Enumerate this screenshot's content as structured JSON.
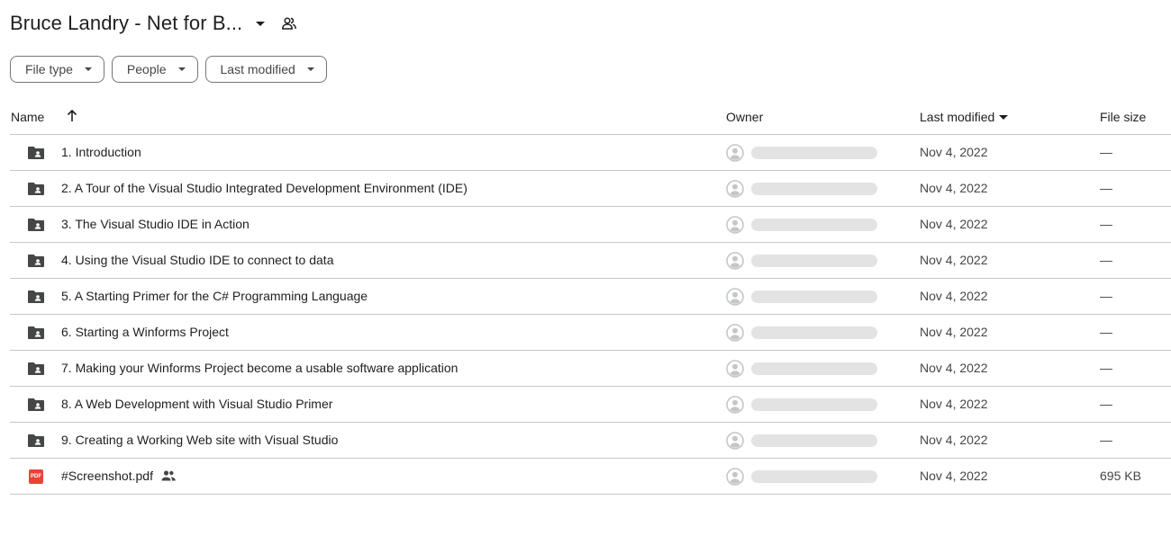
{
  "header": {
    "folder_title": "Bruce Landry - Net for B...",
    "caret_icon": "arrow-drop-down-icon",
    "shared_icon": "people-outline-icon"
  },
  "filters": [
    {
      "label": "File type"
    },
    {
      "label": "People"
    },
    {
      "label": "Last modified"
    }
  ],
  "table": {
    "columns": {
      "name": "Name",
      "owner": "Owner",
      "last_modified": "Last modified",
      "file_size": "File size"
    },
    "sort": {
      "name_arrow": "arrow-upward-icon",
      "modified_caret": "arrow-drop-down-icon"
    },
    "rows": [
      {
        "icon": "shared-folder-icon",
        "name": "1. Introduction",
        "modified": "Nov 4, 2022",
        "size": "—",
        "shared": false
      },
      {
        "icon": "shared-folder-icon",
        "name": "2. A Tour of the Visual Studio Integrated Development Environment (IDE)",
        "modified": "Nov 4, 2022",
        "size": "—",
        "shared": false
      },
      {
        "icon": "shared-folder-icon",
        "name": "3. The Visual Studio IDE in Action",
        "modified": "Nov 4, 2022",
        "size": "—",
        "shared": false
      },
      {
        "icon": "shared-folder-icon",
        "name": "4. Using the Visual Studio IDE to connect to data",
        "modified": "Nov 4, 2022",
        "size": "—",
        "shared": false
      },
      {
        "icon": "shared-folder-icon",
        "name": "5. A Starting Primer for the C# Programming Language",
        "modified": "Nov 4, 2022",
        "size": "—",
        "shared": false
      },
      {
        "icon": "shared-folder-icon",
        "name": "6. Starting a Winforms Project",
        "modified": "Nov 4, 2022",
        "size": "—",
        "shared": false
      },
      {
        "icon": "shared-folder-icon",
        "name": "7. Making your Winforms Project become a usable software application",
        "modified": "Nov 4, 2022",
        "size": "—",
        "shared": false
      },
      {
        "icon": "shared-folder-icon",
        "name": "8. A Web Development with Visual Studio Primer",
        "modified": "Nov 4, 2022",
        "size": "—",
        "shared": false
      },
      {
        "icon": "shared-folder-icon",
        "name": "9. Creating a Working Web site with Visual Studio",
        "modified": "Nov 4, 2022",
        "size": "—",
        "shared": false
      },
      {
        "icon": "pdf-icon",
        "icon_text": "PDF",
        "name": "#Screenshot.pdf",
        "modified": "Nov 4, 2022",
        "size": "695 KB",
        "shared": true
      }
    ]
  },
  "colors": {
    "folder_icon": "#444746",
    "pdf_icon": "#ea4335",
    "avatar": "#c4c7c5",
    "owner_placeholder": "#e3e3e3",
    "divider": "#c7c7c7"
  }
}
